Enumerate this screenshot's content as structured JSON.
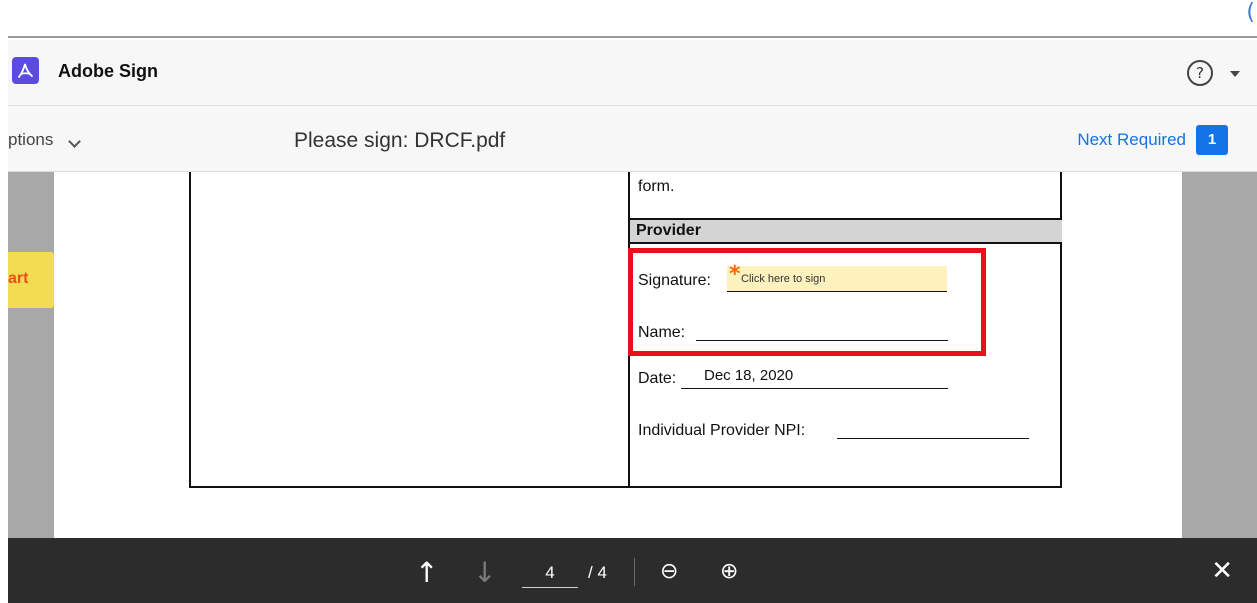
{
  "top_bar": {
    "corner_glyph": "("
  },
  "app": {
    "title": "Adobe Sign",
    "logo_icon": "adobe-acrobat-icon",
    "help_glyph": "?"
  },
  "toolbar": {
    "options_label": "ptions",
    "doc_title": "Please sign: DRCF.pdf",
    "next_required_label": "Next Required",
    "next_required_count": "1"
  },
  "document": {
    "form_text": "form.",
    "section_header": "Provider",
    "fields": {
      "signature_label": "Signature:",
      "signature_hint": "Click here to sign",
      "name_label": "Name:",
      "date_label": "Date:",
      "date_value": "Dec 18, 2020",
      "npi_label": "Individual Provider NPI:"
    },
    "start_tag": "art"
  },
  "bottom_bar": {
    "current_page": "4",
    "total_pages": "/ 4",
    "icons": {
      "prev": "arrow-up-icon",
      "next": "arrow-down-icon",
      "zoom_out": "zoom-out-icon",
      "zoom_in": "zoom-in-icon",
      "close": "close-icon"
    }
  },
  "colors": {
    "accent": "#1473e6",
    "highlight": "#e8101a",
    "start_tag": "#f4dc52",
    "signature_field": "#fdf2bd",
    "bottom_bar": "#2c2c2c"
  }
}
